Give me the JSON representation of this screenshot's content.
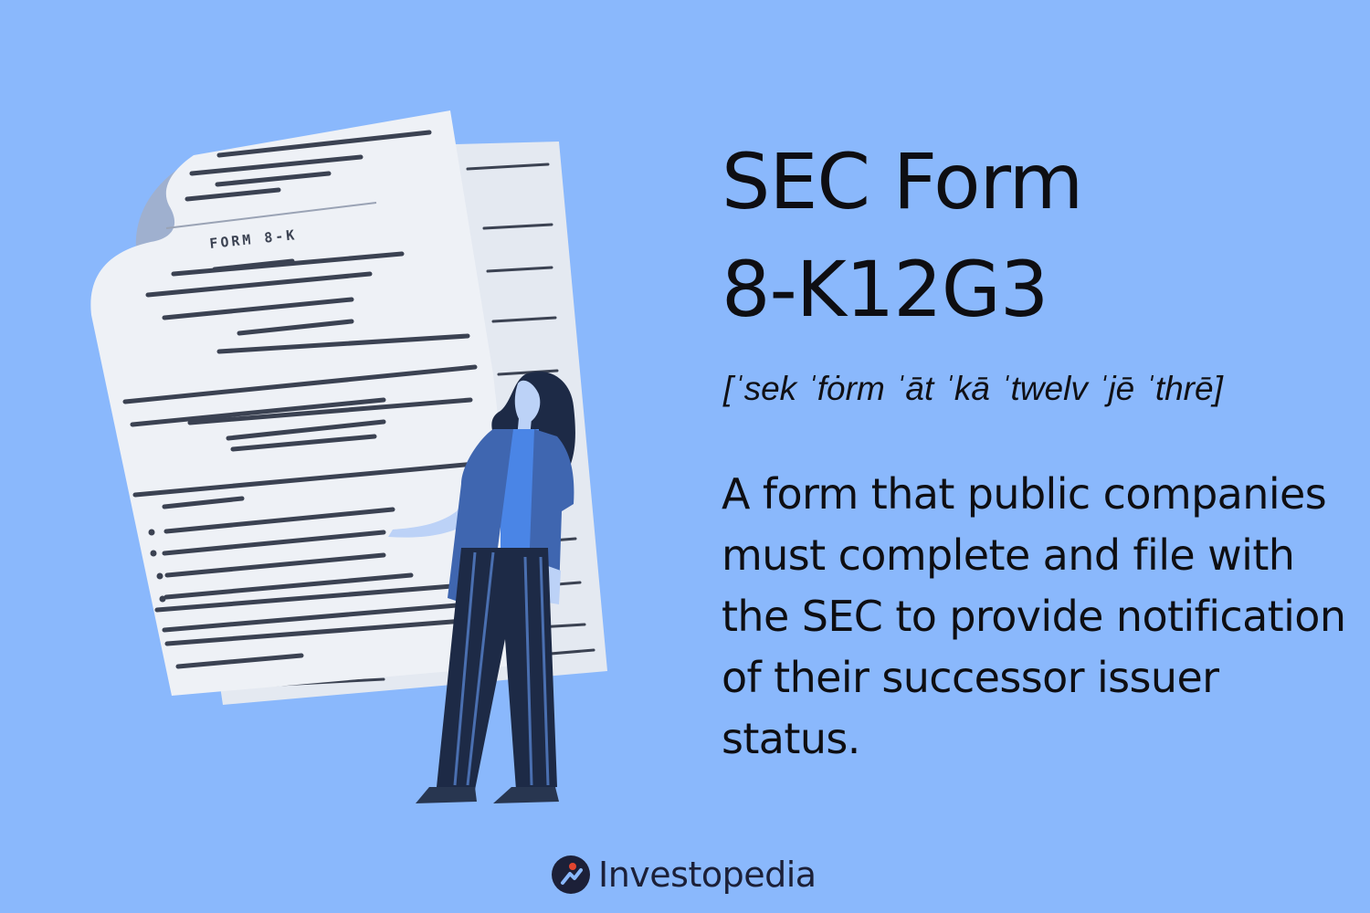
{
  "title": {
    "line1": "SEC Form",
    "line2": "8-K12G3"
  },
  "pronunciation": "[ˈsek ˈfȯrm ˈāt ˈkā ˈtwelv ˈjē ˈthrē]",
  "definition": "A form that public companies must complete and file with the SEC to provide notification of their successor issuer status.",
  "illustration": {
    "form_label": "FORM 8-K"
  },
  "brand": {
    "name": "Investopedia",
    "icon": "investopedia-logo-icon"
  },
  "colors": {
    "background": "#8ab8fc",
    "text": "#0e0e12",
    "paper": "#eef1f6",
    "ink": "#3b4252",
    "brand_accent": "#e2452f"
  }
}
